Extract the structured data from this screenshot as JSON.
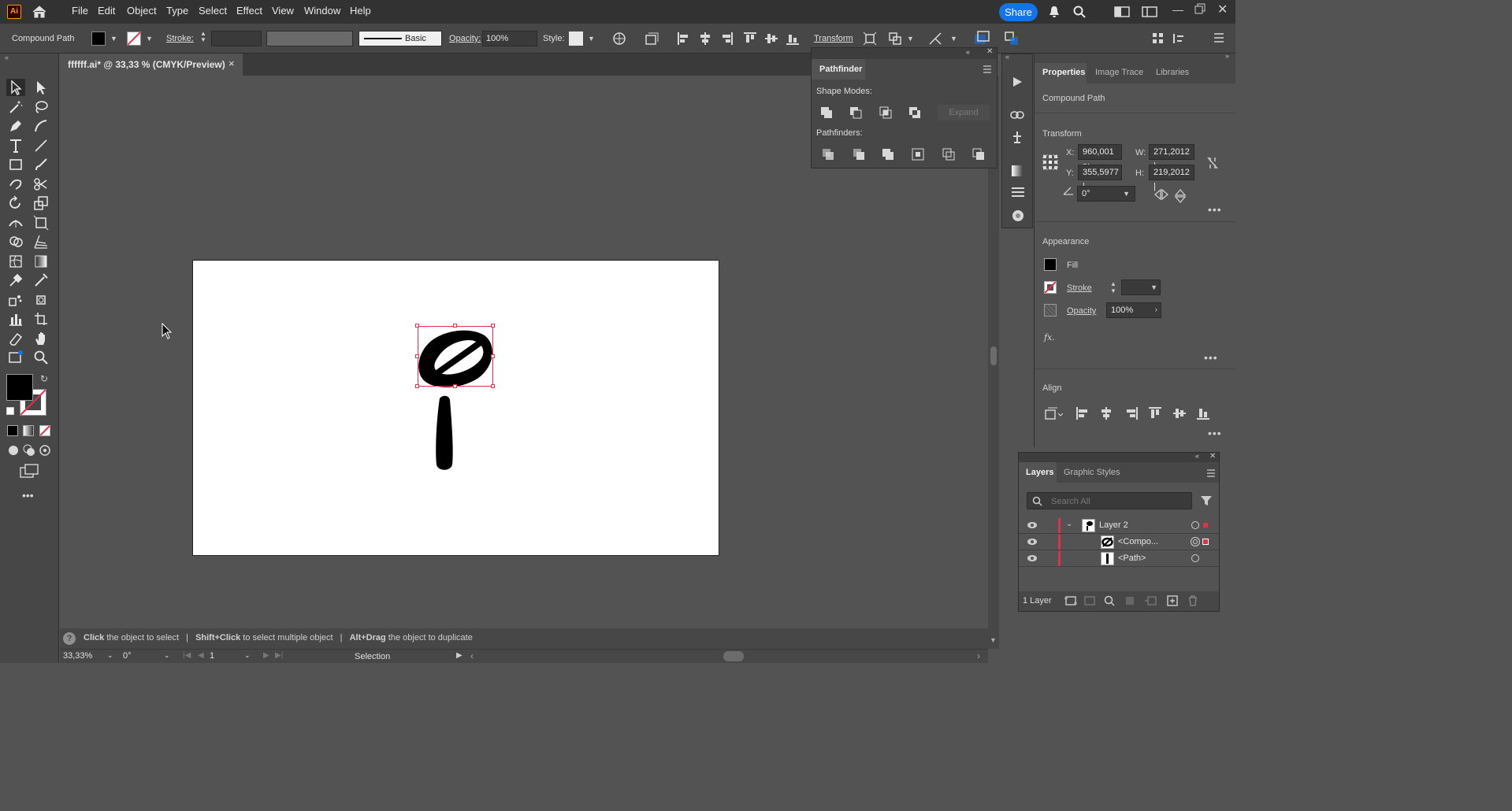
{
  "menubar": {
    "logo": "Ai",
    "items": [
      "File",
      "Edit",
      "Object",
      "Type",
      "Select",
      "Effect",
      "View",
      "Window",
      "Help"
    ],
    "share_label": "Share"
  },
  "controlbar": {
    "selection_type": "Compound Path",
    "stroke_label": "Stroke:",
    "brush_label": "Basic",
    "opacity_label": "Opacity:",
    "opacity_value": "100%",
    "style_label": "Style:",
    "transform_label": "Transform"
  },
  "document": {
    "tab_title": "ffffff.ai* @ 33,33 % (CMYK/Preview)",
    "close_glyph": "×"
  },
  "pathfinder": {
    "title": "Pathfinder",
    "shape_modes_label": "Shape Modes:",
    "expand_label": "Expand",
    "pathfinders_label": "Pathfinders:"
  },
  "properties": {
    "tabs": [
      "Properties",
      "Image Trace",
      "Libraries"
    ],
    "selection_name": "Compound Path",
    "transform": {
      "title": "Transform",
      "x_label": "X:",
      "x_value": "960,001 p:",
      "y_label": "Y:",
      "y_value": "355,5977 |",
      "w_label": "W:",
      "w_value": "271,2012 |",
      "h_label": "H:",
      "h_value": "219,2012 |",
      "angle_value": "0°"
    },
    "appearance": {
      "title": "Appearance",
      "fill_label": "Fill",
      "stroke_label": "Stroke",
      "opacity_label": "Opacity",
      "opacity_value": "100%",
      "fx_label": "fx."
    },
    "align": {
      "title": "Align"
    }
  },
  "layers": {
    "tabs": [
      "Layers",
      "Graphic Styles"
    ],
    "search_placeholder": "Search All",
    "rows": [
      {
        "name": "Layer 2"
      },
      {
        "name": "<Compo..."
      },
      {
        "name": "<Path>"
      }
    ],
    "count_label": "1 Layer"
  },
  "statusbar": {
    "hint_click": "Click",
    "hint_click_rest": " the object to select",
    "hint_shift": "Shift+Click",
    "hint_shift_rest": " to select multiple object",
    "hint_alt": "Alt+Drag",
    "hint_alt_rest": " the object to duplicate",
    "zoom_value": "33,33%",
    "rotate_value": "0°",
    "artboard_value": "1",
    "tool_name": "Selection"
  },
  "colors": {
    "accent": "#1473e6",
    "selection_red": "#e0314b",
    "app_bg": "#535353",
    "panel_bg": "#474747"
  }
}
